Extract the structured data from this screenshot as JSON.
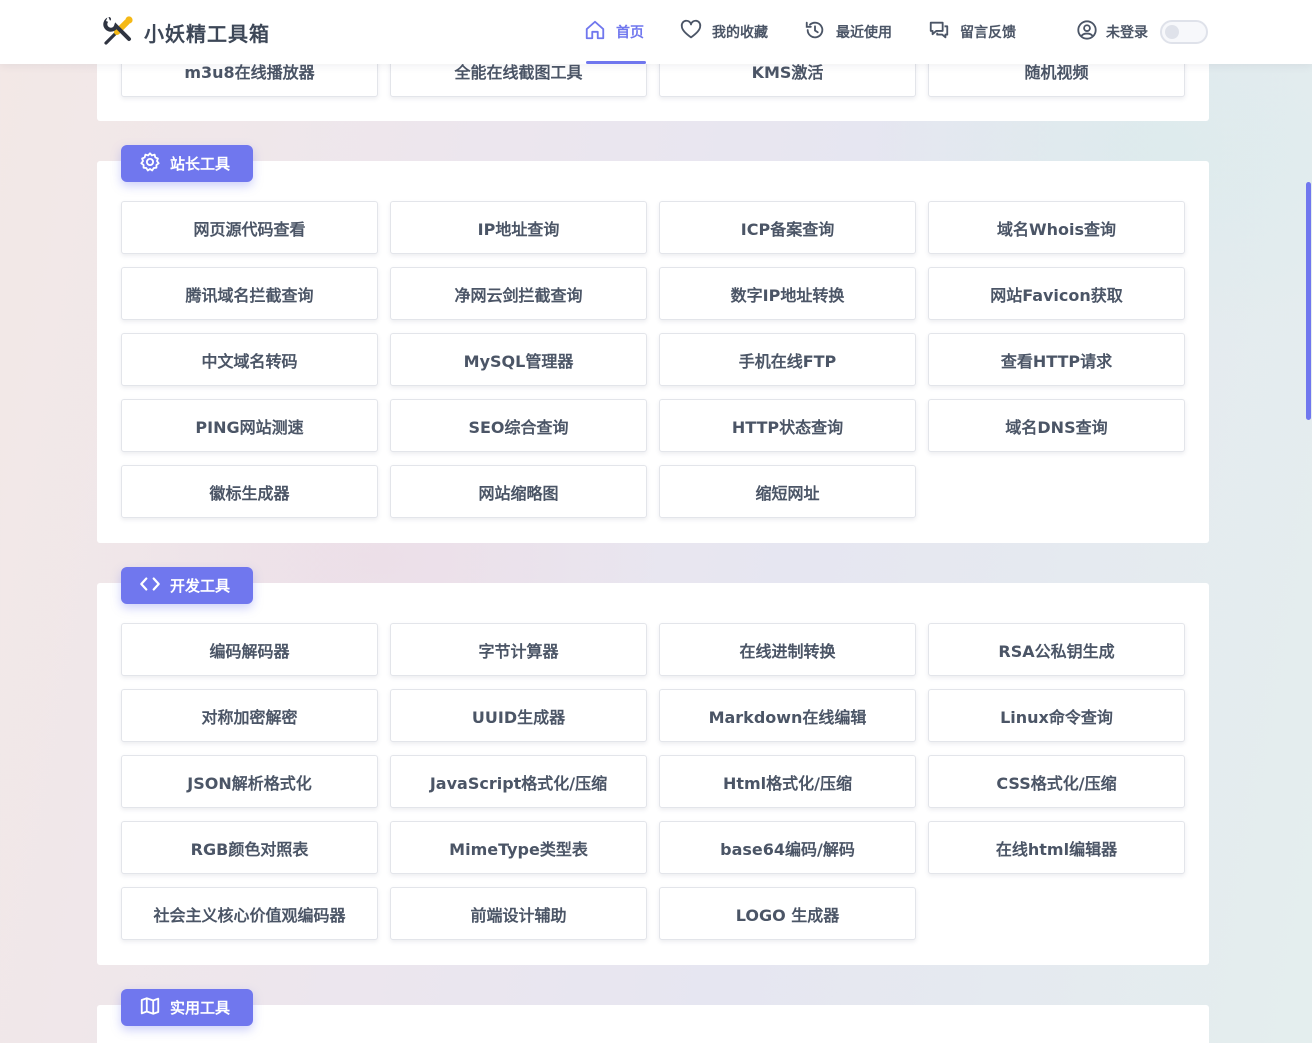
{
  "brand": {
    "name": "小妖精工具箱",
    "logo_icon": "wrench-screwdriver-icon",
    "colors": {
      "accent": "#7077ee",
      "yellow": "#f5b916",
      "dark": "#2f3441"
    }
  },
  "nav": {
    "items": [
      {
        "label": "首页",
        "icon": "home-icon",
        "active": true
      },
      {
        "label": "我的收藏",
        "icon": "heart-icon",
        "active": false
      },
      {
        "label": "最近使用",
        "icon": "history-icon",
        "active": false
      },
      {
        "label": "留言反馈",
        "icon": "chat-icon",
        "active": false
      }
    ],
    "login_label": "未登录",
    "login_icon": "user-circle-icon",
    "theme_toggle": false
  },
  "sections": {
    "top_partial": {
      "tools": [
        "m3u8在线播放器",
        "全能在线截图工具",
        "KMS激活",
        "随机视频"
      ]
    },
    "webmaster": {
      "title": "站长工具",
      "icon": "gear-icon",
      "tools": [
        "网页源代码查看",
        "IP地址查询",
        "ICP备案查询",
        "域名Whois查询",
        "腾讯域名拦截查询",
        "净网云剑拦截查询",
        "数字IP地址转换",
        "网站Favicon获取",
        "中文域名转码",
        "MySQL管理器",
        "手机在线FTP",
        "查看HTTP请求",
        "PING网站测速",
        "SEO综合查询",
        "HTTP状态查询",
        "域名DNS查询",
        "徽标生成器",
        "网站缩略图",
        "缩短网址"
      ]
    },
    "dev": {
      "title": "开发工具",
      "icon": "code-icon",
      "tools": [
        "编码解码器",
        "字节计算器",
        "在线进制转换",
        "RSA公私钥生成",
        "对称加密解密",
        "UUID生成器",
        "Markdown在线编辑",
        "Linux命令查询",
        "JSON解析格式化",
        "JavaScript格式化/压缩",
        "Html格式化/压缩",
        "CSS格式化/压缩",
        "RGB颜色对照表",
        "MimeType类型表",
        "base64编码/解码",
        "在线html编辑器",
        "社会主义核心价值观编码器",
        "前端设计辅助",
        "LOGO 生成器"
      ]
    },
    "util": {
      "title": "实用工具",
      "icon": "map-icon"
    }
  }
}
